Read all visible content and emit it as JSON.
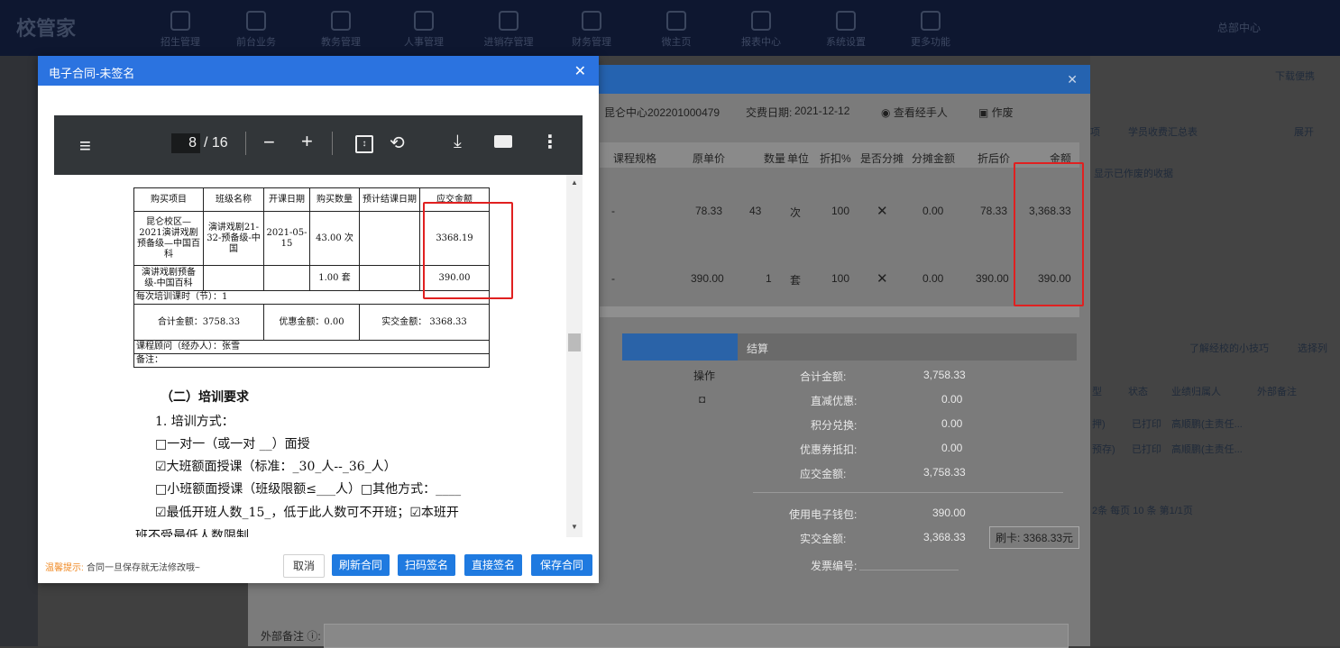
{
  "app": {
    "logo": "校管家",
    "nav": [
      "招生管理",
      "前台业务",
      "教务管理",
      "人事管理",
      "进销存管理",
      "财务管理",
      "微主页",
      "报表中心",
      "系统设置",
      "更多功能"
    ],
    "center_menu": "总部中心",
    "right_link": "下载便携",
    "right_panel": {
      "tabs": [
        "项",
        "学员收费汇总表",
        "展开"
      ],
      "hint": "显示已作废的收据",
      "link": "了解经校的小技巧",
      "select_col": "选择列",
      "table_head": [
        "型",
        "状态",
        "业绩归属人",
        "外部备注"
      ],
      "rows": [
        [
          "押)",
          "已打印",
          "高顺鹏(主责任..."
        ],
        [
          "预存)",
          "已打印",
          "高顺鹏(主责任..."
        ]
      ],
      "pager": "2条 每页 10 条 第1/1页"
    }
  },
  "order": {
    "order_no": "昆仑中心202201000479",
    "pay_date_label": "交费日期:",
    "pay_date": "2021-12-12",
    "view_handler": "查看经手人",
    "void": "作废",
    "columns": [
      "课程规格",
      "原单价",
      "数量",
      "单位",
      "折扣%",
      "是否分摊",
      "分摊金额",
      "折后价",
      "金额"
    ],
    "rows": [
      {
        "spec": "-",
        "price": "78.33",
        "qty": "43",
        "unit": "次",
        "discount": "100",
        "split": "✕",
        "split_amt": "0.00",
        "after": "78.33",
        "amount": "3,368.33"
      },
      {
        "spec": "-",
        "price": "390.00",
        "qty": "1",
        "unit": "套",
        "discount": "100",
        "split": "✕",
        "split_amt": "0.00",
        "after": "390.00",
        "amount": "390.00"
      }
    ],
    "op_label": "操作",
    "settle_title": "结算",
    "settle": [
      {
        "label": "合计金额:",
        "value": "3,758.33"
      },
      {
        "label": "直减优惠:",
        "value": "0.00"
      },
      {
        "label": "积分兑换:",
        "value": "0.00"
      },
      {
        "label": "优惠券抵扣:",
        "value": "0.00"
      },
      {
        "label": "应交金额:",
        "value": "3,758.33"
      },
      {
        "label": "使用电子钱包:",
        "value": "390.00"
      },
      {
        "label": "实交金额:",
        "value": "3,368.33"
      },
      {
        "label": "发票编号:",
        "value": ""
      }
    ],
    "card_tag": "刷卡: 3368.33元",
    "remark_label": "外部备注 ⓘ:"
  },
  "modal": {
    "title": "电子合同-未签名",
    "pdf": {
      "page": "8",
      "total": "/ 16"
    },
    "table": {
      "head": [
        "购买项目",
        "班级名称",
        "开课日期",
        "购买数量",
        "预计结课日期",
        "应交金额"
      ],
      "row1": [
        "昆仑校区—2021演讲戏剧预备级—中国百科",
        "演讲戏剧21-32-预备级-中国",
        "2021-05-15",
        "43.00 次",
        "",
        "3368.19"
      ],
      "row2": [
        "演讲戏剧预备级-中国百科",
        "",
        "",
        "1.00 套",
        "",
        "390.00"
      ],
      "hours": "每次培训课时（节）：1",
      "total": "合计金额：3758.33",
      "discount": "优惠金额：0.00",
      "paid": "实交金额：  3368.33",
      "advisor": "课程顾问（经办人）：张雪",
      "note": "备注："
    },
    "section_title": "（二）培训要求",
    "lines": [
      "1. 培训方式：",
      "□一对一（或一对 __）面授",
      "☑大班额面授课（标准：_30_人--_36_人）",
      "□小班额面授课（班级限额≤___人）□其他方式：____",
      " ☑最低开班人数_15_，低于此人数可不开班；☑本班开",
      "班不受最低人数限制"
    ],
    "footer_hint_label": "温馨提示:",
    "footer_hint": "合同一旦保存就无法修改哦~",
    "buttons": {
      "cancel": "取消",
      "refresh": "刷新合同",
      "scan": "扫码签名",
      "direct": "直接签名",
      "save": "保存合同"
    }
  }
}
